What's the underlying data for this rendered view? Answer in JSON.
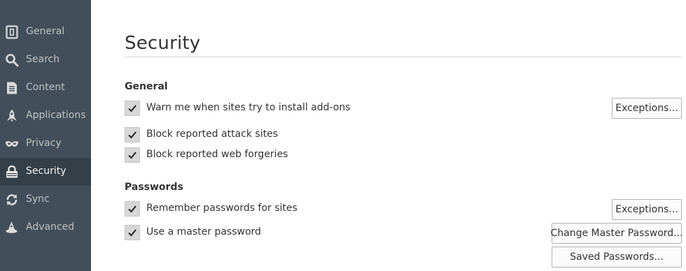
{
  "sidebar": {
    "items": [
      {
        "label": "General",
        "icon": "general-icon",
        "selected": false
      },
      {
        "label": "Search",
        "icon": "search-icon",
        "selected": false
      },
      {
        "label": "Content",
        "icon": "content-icon",
        "selected": false
      },
      {
        "label": "Applications",
        "icon": "applications-icon",
        "selected": false
      },
      {
        "label": "Privacy",
        "icon": "privacy-mask-icon",
        "selected": false
      },
      {
        "label": "Security",
        "icon": "security-lock-icon",
        "selected": true
      },
      {
        "label": "Sync",
        "icon": "sync-icon",
        "selected": false
      },
      {
        "label": "Advanced",
        "icon": "advanced-wizard-icon",
        "selected": false
      }
    ]
  },
  "main": {
    "title": "Security",
    "general": {
      "heading": "General",
      "warn_addons_label": "Warn me when sites try to install add-ons",
      "warn_addons_checked": true,
      "addon_exceptions_label": "Exceptions...",
      "block_attack_label": "Block reported attack sites",
      "block_attack_checked": true,
      "block_forgeries_label": "Block reported web forgeries",
      "block_forgeries_checked": true
    },
    "passwords": {
      "heading": "Passwords",
      "remember_label": "Remember passwords for sites",
      "remember_checked": true,
      "exceptions_label": "Exceptions...",
      "master_label": "Use a master password",
      "master_checked": true,
      "change_master_label": "Change Master Password...",
      "saved_passwords_label": "Saved Passwords..."
    }
  },
  "colors": {
    "sidebar_bg": "#424f5a",
    "sidebar_selected_bg": "#343f48",
    "sidebar_text": "#c1c1c1",
    "checkbox_bg": "#d7d7d7",
    "content_text": "#333333"
  }
}
